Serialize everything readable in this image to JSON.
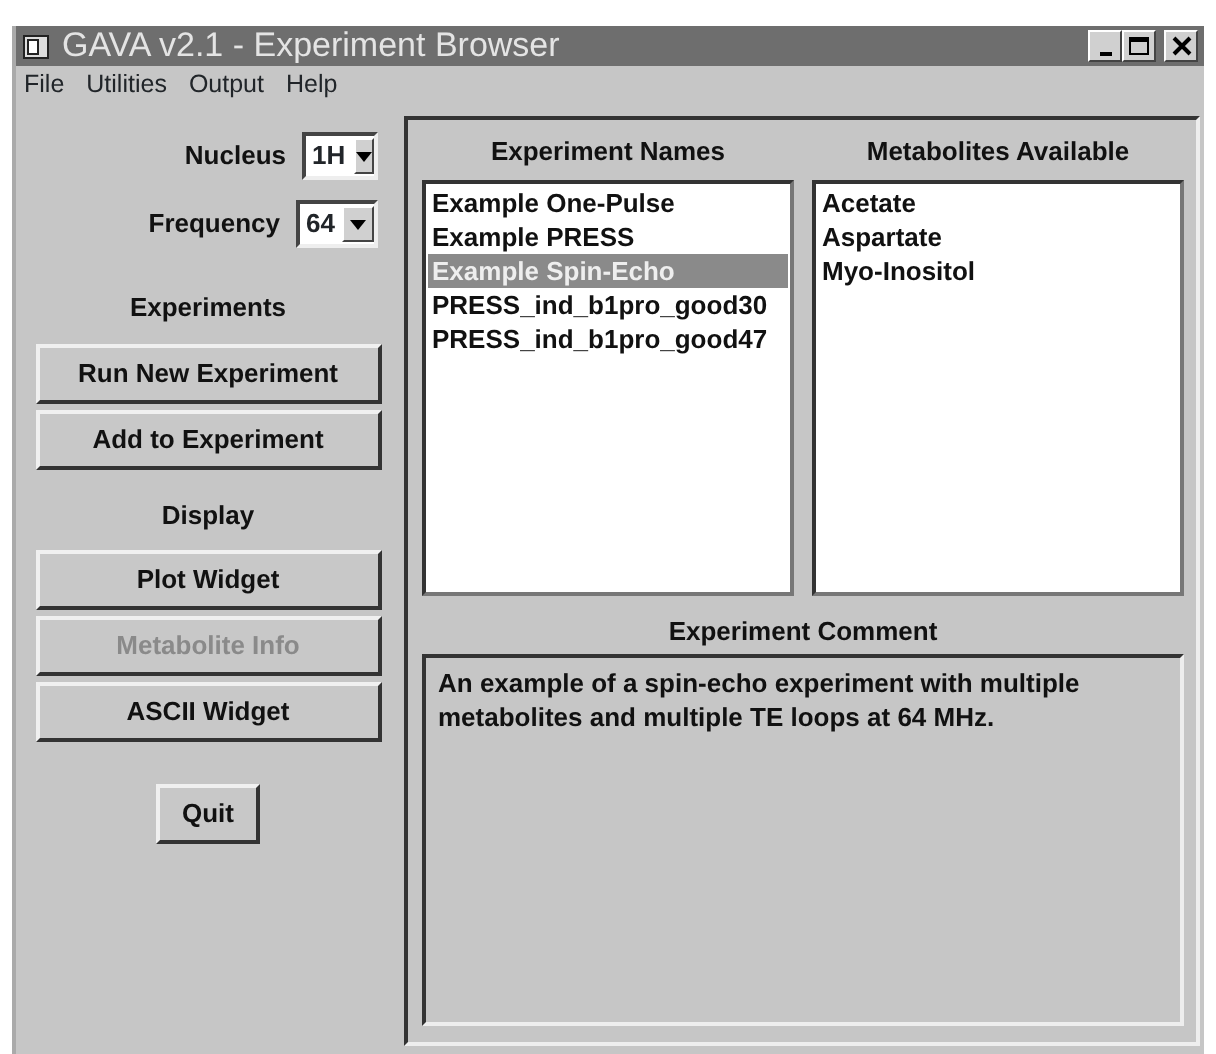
{
  "window": {
    "title": "GAVA v2.1 - Experiment Browser"
  },
  "menu": [
    "File",
    "Utilities",
    "Output",
    "Help"
  ],
  "controls": [
    {
      "label": "Nucleus",
      "value": "1H"
    },
    {
      "label": "Frequency",
      "value": "64"
    }
  ],
  "sidebar": [
    {
      "kind": "heading",
      "text": "Experiments"
    },
    {
      "kind": "button",
      "text": "Run New Experiment",
      "disabled": false
    },
    {
      "kind": "button",
      "text": "Add to Experiment",
      "disabled": false
    },
    {
      "kind": "heading",
      "text": "Display"
    },
    {
      "kind": "button",
      "text": "Plot Widget",
      "disabled": false
    },
    {
      "kind": "button",
      "text": "Metabolite Info",
      "disabled": true
    },
    {
      "kind": "button",
      "text": "ASCII Widget",
      "disabled": false
    },
    {
      "kind": "quit",
      "text": "Quit",
      "disabled": false
    }
  ],
  "experiments": {
    "title": "Experiment Names",
    "items": [
      {
        "text": "Example One-Pulse",
        "selected": false
      },
      {
        "text": "Example PRESS",
        "selected": false
      },
      {
        "text": "Example Spin-Echo",
        "selected": true
      },
      {
        "text": "PRESS_ind_b1pro_good30",
        "selected": false
      },
      {
        "text": "PRESS_ind_b1pro_good47",
        "selected": false
      }
    ]
  },
  "metabolites": {
    "title": "Metabolites Available",
    "items": [
      {
        "text": "Acetate",
        "selected": false
      },
      {
        "text": "Aspartate",
        "selected": false
      },
      {
        "text": "Myo-Inositol",
        "selected": false
      }
    ]
  },
  "comment": {
    "title": "Experiment Comment",
    "text": "An example of a spin-echo experiment with multiple metabolites and multiple TE loops at 64 MHz."
  }
}
